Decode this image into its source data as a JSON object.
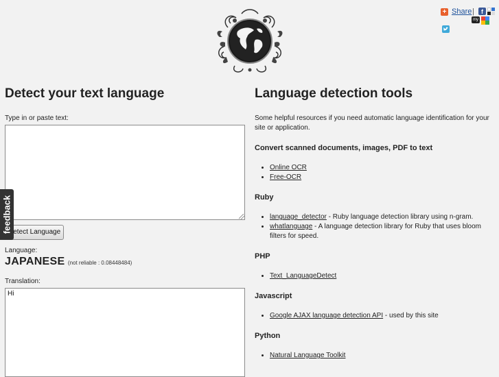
{
  "share": {
    "label": "Share",
    "separator": "|",
    "my_label": "my"
  },
  "left": {
    "title": "Detect your text language",
    "input_label": "Type in or paste text:",
    "input_value": "",
    "button_label": "Detect Language",
    "language_label": "Language:",
    "language_value": "JAPANESE",
    "language_note": "(not reliable : 0.08448484)",
    "translation_label": "Translation:",
    "translation_value": "Hi"
  },
  "right": {
    "title": "Language detection tools",
    "intro": "Some helpful resources if you need automatic language identification for your site or application.",
    "sections": [
      {
        "heading": "Convert scanned documents, images, PDF to text",
        "items": [
          {
            "link": "Online OCR",
            "desc": ""
          },
          {
            "link": "Free-OCR",
            "desc": ""
          }
        ]
      },
      {
        "heading": "Ruby",
        "items": [
          {
            "link": "language_detector",
            "desc": " - Ruby language detection library using n-gram."
          },
          {
            "link": "whatlanguage",
            "desc": " - A language detection library for Ruby that uses bloom filters for speed."
          }
        ]
      },
      {
        "heading": "PHP",
        "items": [
          {
            "link": "Text_LanguageDetect",
            "desc": ""
          }
        ]
      },
      {
        "heading": "Javascript",
        "items": [
          {
            "link": "Google AJAX language detection API",
            "desc": " - used by this site"
          }
        ]
      },
      {
        "heading": "Python",
        "items": [
          {
            "link": "Natural Language Toolkit",
            "desc": ""
          }
        ]
      }
    ]
  },
  "feedback_label": "feedback",
  "icons": {
    "logo": "globe-flourish-logo",
    "share": "addthis-plus-icon",
    "facebook": "facebook-icon",
    "delicious": "delicious-icon",
    "myspace": "myspace-icon",
    "google": "google-icon",
    "twitter": "twitter-icon"
  },
  "colors": {
    "background": "#f2f2f2",
    "share_link": "#1a4f9a",
    "feedback_tab": "#333333"
  }
}
